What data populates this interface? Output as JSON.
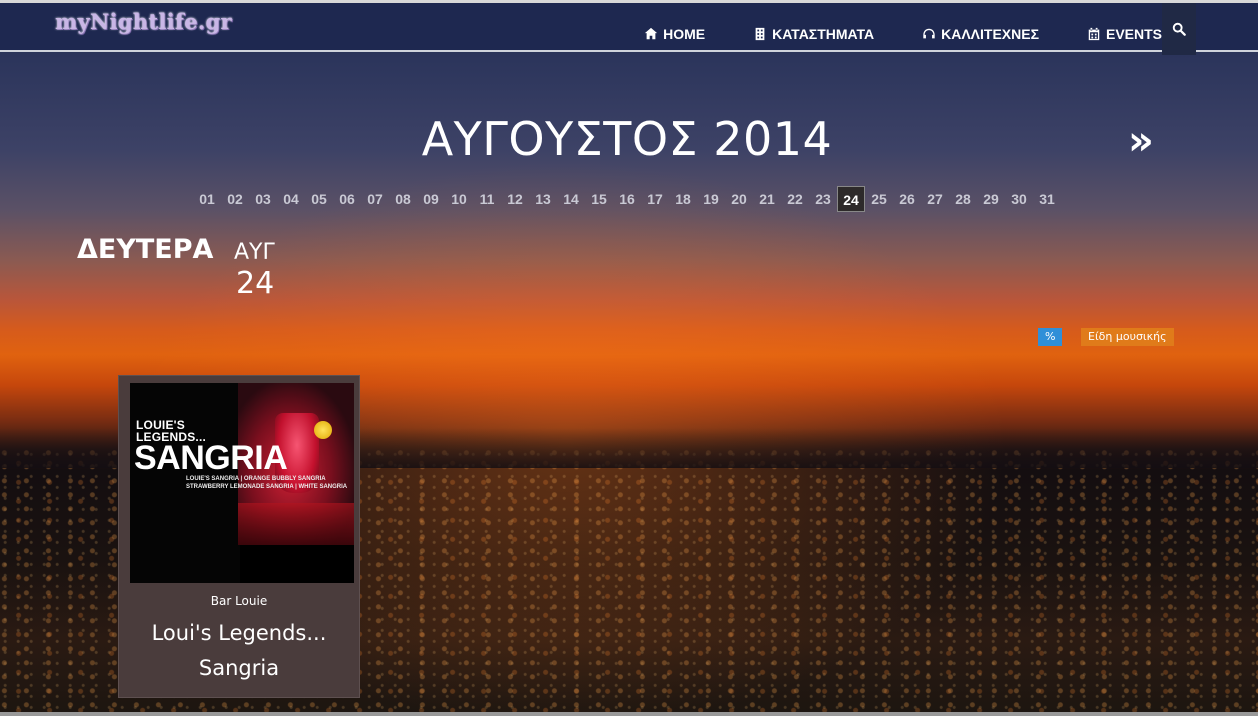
{
  "site": {
    "logo": "myNightlife.gr"
  },
  "nav": {
    "items": [
      {
        "label": "HOME",
        "icon": "home-icon"
      },
      {
        "label": "ΚΑΤΑΣΤΗΜΑΤΑ",
        "icon": "building-icon"
      },
      {
        "label": "ΚΑΛΛΙΤΕΧΝΕΣ",
        "icon": "headphones-icon"
      },
      {
        "label": "EVENTS",
        "icon": "calendar-icon"
      }
    ],
    "search_icon": "search-icon"
  },
  "calendar": {
    "month_title": "ΑΥΓΟΥΣΤΟΣ 2014",
    "next_label": "»",
    "days": [
      "01",
      "02",
      "03",
      "04",
      "05",
      "06",
      "07",
      "08",
      "09",
      "10",
      "11",
      "12",
      "13",
      "14",
      "15",
      "16",
      "17",
      "18",
      "19",
      "20",
      "21",
      "22",
      "23",
      "24",
      "25",
      "26",
      "27",
      "28",
      "29",
      "30",
      "31"
    ],
    "selected_day": "24"
  },
  "selected_date": {
    "weekday": "ΔΕΥΤΕΡΑ",
    "month_abbr": "ΑΥΓ",
    "day": "24"
  },
  "filters": {
    "percent_label": "%",
    "genre_label": "Είδη μουσικής"
  },
  "event": {
    "image_title_line1": "LOUIE'S",
    "image_title_line2": "LEGENDS...",
    "image_title_big": "SANGRIA",
    "image_subtitle_line1": "LOUIE'S SANGRIA | ORANGE BUBBLY SANGRIA",
    "image_subtitle_line2": "STRAWBERRY LEMONADE SANGRIA | WHITE SANGRIA",
    "venue": "Bar Louie",
    "title": "Loui's Legends... Sangria"
  },
  "colors": {
    "header_bg": "#1e2850",
    "active_day_bg": "#2d2a2a",
    "percent_tag": "#2f8fd8",
    "genre_tag": "#e07b1a",
    "card_bg": "#4a3c3c"
  }
}
